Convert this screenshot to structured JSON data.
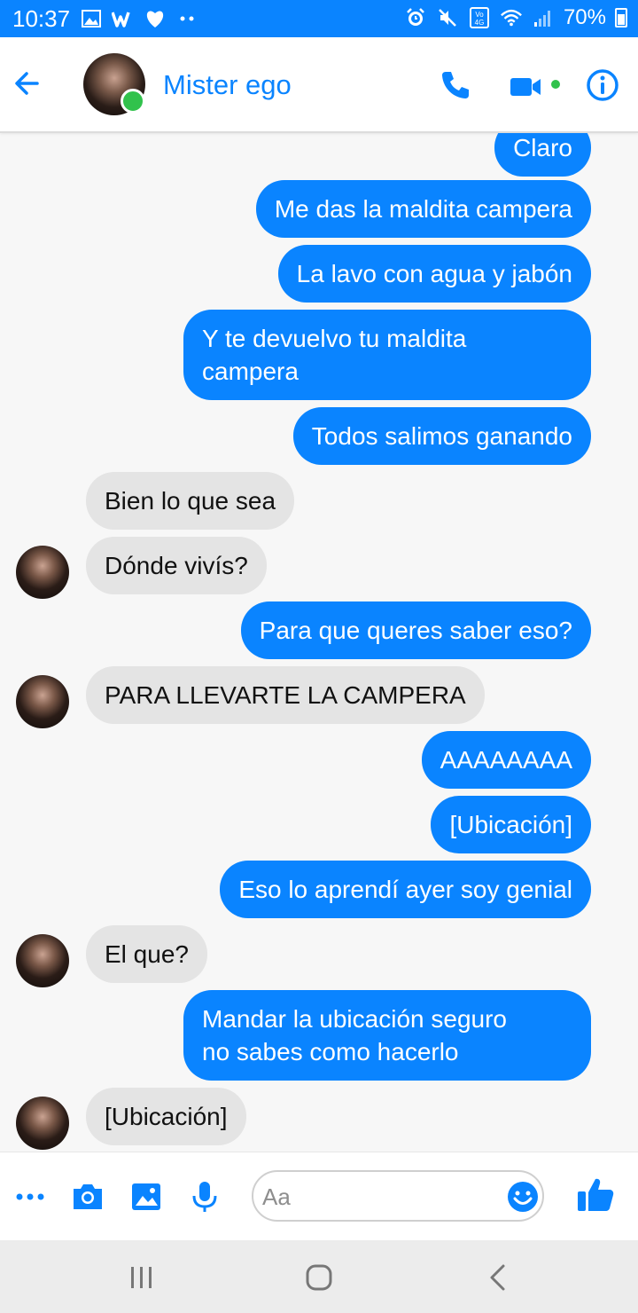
{
  "status_bar": {
    "time": "10:37",
    "battery": "70%",
    "network_label": "Vo) 4G"
  },
  "header": {
    "contact_name": "Mister ego",
    "online": true
  },
  "messages": [
    {
      "dir": "out",
      "text": "Claro"
    },
    {
      "dir": "out",
      "text": "Me das la maldita campera"
    },
    {
      "dir": "out",
      "text": "La lavo con agua y jabón"
    },
    {
      "dir": "out",
      "text": "Y te devuelvo tu maldita\ncampera"
    },
    {
      "dir": "out",
      "text": "Todos salimos ganando"
    },
    {
      "dir": "in",
      "text": "Bien lo que sea",
      "avatar": false
    },
    {
      "dir": "in",
      "text": "Dónde vivís?",
      "avatar": true
    },
    {
      "dir": "out",
      "text": "Para que queres saber eso?"
    },
    {
      "dir": "in",
      "text": "PARA LLEVARTE LA CAMPERA",
      "avatar": true
    },
    {
      "dir": "out",
      "text": "AAAAAAAA"
    },
    {
      "dir": "out",
      "text": "[Ubicación]"
    },
    {
      "dir": "out",
      "text": "Eso lo aprendí ayer soy genial"
    },
    {
      "dir": "in",
      "text": "El que?",
      "avatar": true
    },
    {
      "dir": "out",
      "text": "Mandar la ubicación seguro\nno sabes como hacerlo"
    },
    {
      "dir": "in",
      "text": "[Ubicación]",
      "avatar": true
    }
  ],
  "composer": {
    "placeholder": "Aa"
  },
  "colors": {
    "accent": "#0a84ff",
    "incoming_bubble": "#e4e4e4",
    "online": "#31c24c"
  }
}
